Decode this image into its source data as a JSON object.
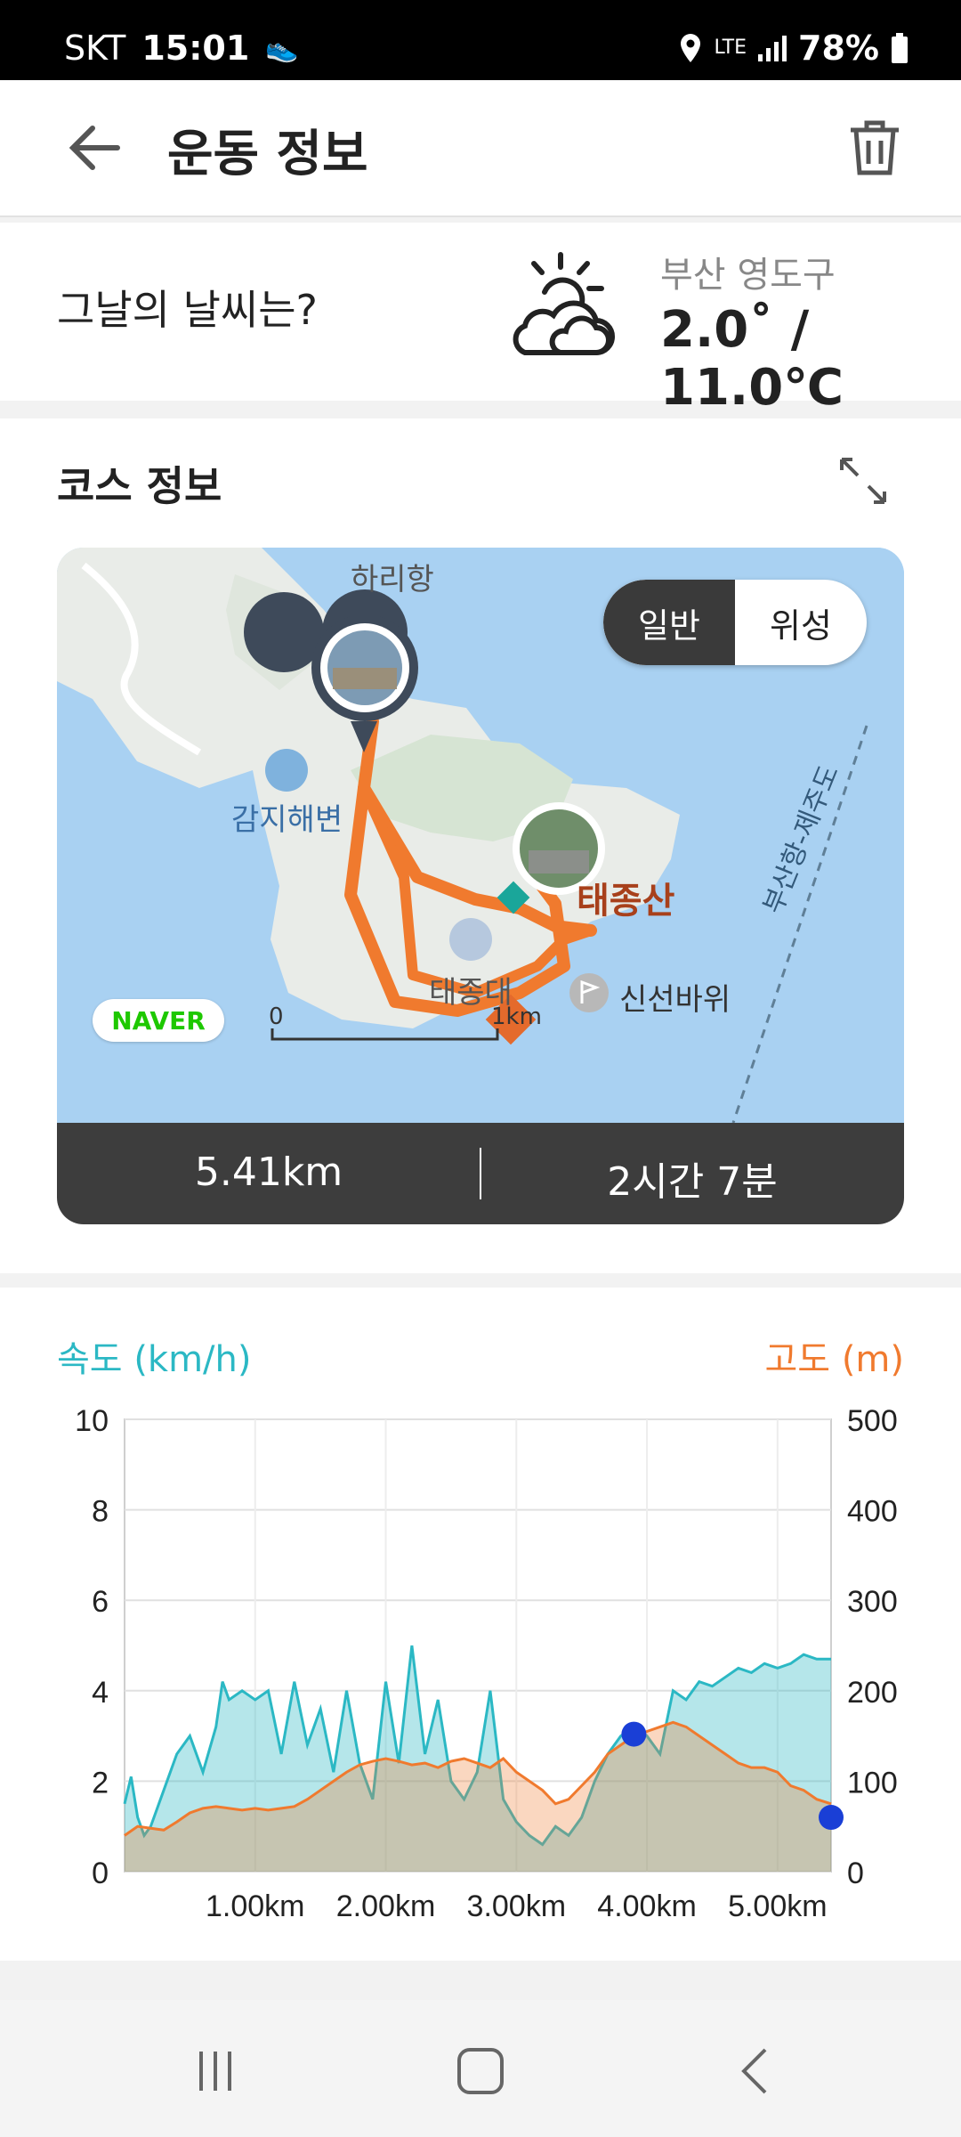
{
  "status": {
    "carrier": "SKT",
    "time": "15:01",
    "network": "LTE",
    "battery": "78%"
  },
  "header": {
    "title": "운동 정보"
  },
  "weather": {
    "question": "그날의 날씨는?",
    "location": "부산 영도구",
    "temperature": "2.0˚ / 11.0℃"
  },
  "course": {
    "title": "코스 정보",
    "toggle": {
      "normal": "일반",
      "satellite": "위성"
    },
    "map_labels": {
      "port": "하리항",
      "beach": "감지해변",
      "mountain": "태종산",
      "park": "태종대",
      "rock": "신선바위",
      "ferry": "부산항-제주도",
      "scale_zero": "0",
      "scale_km": "1km"
    },
    "naver": "NAVER",
    "distance": "5.41km",
    "duration": "2시간 7분"
  },
  "chart_legend": {
    "speed": "속도 (km/h)",
    "altitude": "고도 (m)"
  },
  "chart_data": {
    "type": "area",
    "x_ticks": [
      "1.00km",
      "2.00km",
      "3.00km",
      "4.00km",
      "5.00km"
    ],
    "speed_ticks": [
      "0",
      "2",
      "4",
      "6",
      "8",
      "10"
    ],
    "altitude_ticks": [
      "0",
      "100",
      "200",
      "300",
      "400",
      "500"
    ],
    "xlim": [
      0,
      5.41
    ],
    "ylim_left": [
      0,
      10
    ],
    "ylim_right": [
      0,
      500
    ],
    "grid": true,
    "colors": {
      "speed": "#2bb8c4",
      "altitude": "#f07a2e",
      "marker": "#1a3fd6"
    },
    "series": [
      {
        "name": "속도 (km/h)",
        "axis": "left",
        "x": [
          0.0,
          0.05,
          0.1,
          0.15,
          0.2,
          0.3,
          0.4,
          0.5,
          0.6,
          0.7,
          0.75,
          0.8,
          0.9,
          1.0,
          1.1,
          1.2,
          1.3,
          1.4,
          1.5,
          1.6,
          1.7,
          1.8,
          1.9,
          2.0,
          2.1,
          2.2,
          2.3,
          2.4,
          2.5,
          2.6,
          2.7,
          2.8,
          2.9,
          3.0,
          3.1,
          3.2,
          3.3,
          3.4,
          3.5,
          3.6,
          3.7,
          3.8,
          3.9,
          4.0,
          4.1,
          4.2,
          4.3,
          4.4,
          4.5,
          4.6,
          4.7,
          4.8,
          4.9,
          5.0,
          5.1,
          5.2,
          5.3,
          5.41
        ],
        "values": [
          1.5,
          2.1,
          1.2,
          0.8,
          1.0,
          1.8,
          2.6,
          3.0,
          2.2,
          3.2,
          4.2,
          3.8,
          4.0,
          3.8,
          4.0,
          2.6,
          4.2,
          2.8,
          3.6,
          2.2,
          4.0,
          2.4,
          1.6,
          4.2,
          2.4,
          5.0,
          2.6,
          3.8,
          2.0,
          1.6,
          2.2,
          4.0,
          1.6,
          1.1,
          0.8,
          0.6,
          1.0,
          0.8,
          1.2,
          2.0,
          2.6,
          3.0,
          3.2,
          3.0,
          2.6,
          4.0,
          3.8,
          4.2,
          4.1,
          4.3,
          4.5,
          4.4,
          4.6,
          4.5,
          4.6,
          4.8,
          4.7,
          4.7
        ]
      },
      {
        "name": "고도 (m)",
        "axis": "right",
        "x": [
          0.0,
          0.1,
          0.2,
          0.3,
          0.4,
          0.5,
          0.6,
          0.7,
          0.8,
          0.9,
          1.0,
          1.1,
          1.2,
          1.3,
          1.4,
          1.5,
          1.6,
          1.7,
          1.8,
          1.9,
          2.0,
          2.1,
          2.2,
          2.3,
          2.4,
          2.5,
          2.6,
          2.7,
          2.8,
          2.9,
          3.0,
          3.1,
          3.2,
          3.3,
          3.4,
          3.5,
          3.6,
          3.7,
          3.8,
          3.9,
          4.0,
          4.1,
          4.2,
          4.3,
          4.4,
          4.5,
          4.6,
          4.7,
          4.8,
          4.9,
          5.0,
          5.1,
          5.2,
          5.3,
          5.41
        ],
        "values": [
          40,
          50,
          48,
          46,
          55,
          65,
          70,
          72,
          70,
          68,
          70,
          68,
          70,
          72,
          80,
          90,
          100,
          110,
          118,
          122,
          125,
          122,
          118,
          120,
          115,
          122,
          125,
          120,
          115,
          125,
          110,
          100,
          90,
          75,
          80,
          95,
          110,
          130,
          140,
          150,
          155,
          160,
          165,
          160,
          150,
          140,
          130,
          120,
          115,
          115,
          110,
          95,
          90,
          80,
          75
        ]
      }
    ],
    "markers": [
      {
        "series": "고도 (m)",
        "x": 3.9,
        "value": 152
      },
      {
        "series": "고도 (m)",
        "x": 5.41,
        "value": 60
      }
    ]
  }
}
